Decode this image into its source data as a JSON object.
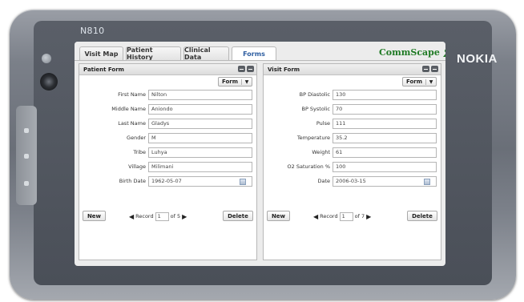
{
  "device": {
    "model": "N810",
    "brand": "NOKIA"
  },
  "tabs": [
    {
      "label": "Visit Map",
      "active": false
    },
    {
      "label": "Patient History",
      "active": false
    },
    {
      "label": "Clinical Data",
      "active": false
    },
    {
      "label": "Forms",
      "active": true
    }
  ],
  "logo": {
    "text": "CommScape",
    "icon": "person-icon",
    "color": "#1f7a24"
  },
  "patient_form": {
    "title": "Patient Form",
    "form_button": "Form",
    "fields": [
      {
        "label": "First Name",
        "value": "Nilton"
      },
      {
        "label": "Middle Name",
        "value": "Aniondo"
      },
      {
        "label": "Last Name",
        "value": "Gladys"
      },
      {
        "label": "Gender",
        "value": "M"
      },
      {
        "label": "Tribe",
        "value": "Luhya"
      },
      {
        "label": "Village",
        "value": "Milimani"
      },
      {
        "label": "Birth Date",
        "value": "1962-05-07"
      }
    ],
    "new_button": "New",
    "delete_button": "Delete",
    "record_label": "Record",
    "record_value": "1",
    "record_of": "of 5"
  },
  "visit_form": {
    "title": "Visit Form",
    "form_button": "Form",
    "fields": [
      {
        "label": "BP Diastolic",
        "value": "130"
      },
      {
        "label": "BP Systolic",
        "value": "70"
      },
      {
        "label": "Pulse",
        "value": "111"
      },
      {
        "label": "Temperature",
        "value": "35.2"
      },
      {
        "label": "Weight",
        "value": "61"
      },
      {
        "label": "O2 Saturation %",
        "value": "100"
      },
      {
        "label": "Date",
        "value": "2006-03-15"
      }
    ],
    "new_button": "New",
    "delete_button": "Delete",
    "record_label": "Record",
    "record_value": "1",
    "record_of": "of 7"
  }
}
